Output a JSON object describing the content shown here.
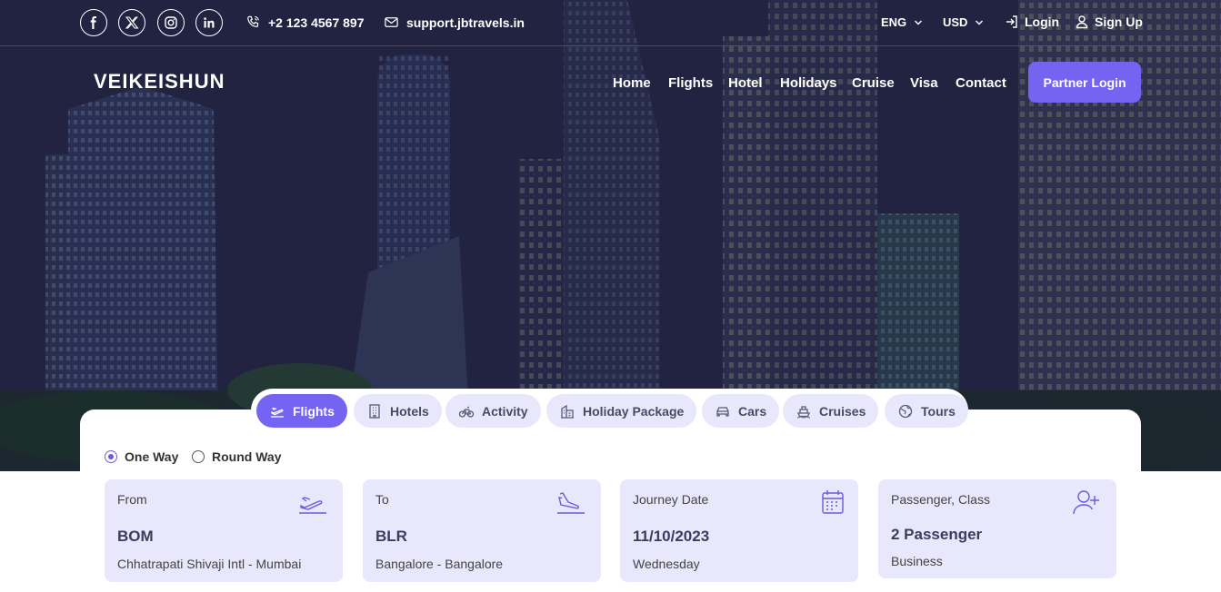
{
  "topbar": {
    "socials": [
      "facebook-icon",
      "x-icon",
      "instagram-icon",
      "linkedin-icon"
    ],
    "phone": "+2 123 4567 897",
    "email": "support.jbtravels.in",
    "language": "ENG",
    "currency": "USD",
    "login": "Login",
    "signup": "Sign Up"
  },
  "header": {
    "logo": "VEIKEISHUN",
    "nav": [
      "Home",
      "Flights",
      "Hotel",
      "Holidays",
      "Cruise",
      "Visa",
      "Contact"
    ],
    "partner_login": "Partner Login"
  },
  "search": {
    "tabs": [
      {
        "label": "Flights",
        "icon": "plane-icon",
        "active": true
      },
      {
        "label": "Hotels",
        "icon": "building-icon",
        "active": false
      },
      {
        "label": "Activity",
        "icon": "bicycle-icon",
        "active": false
      },
      {
        "label": "Holiday Package",
        "icon": "holiday-icon",
        "active": false
      },
      {
        "label": "Cars",
        "icon": "car-icon",
        "active": false
      },
      {
        "label": "Cruises",
        "icon": "ship-icon",
        "active": false
      },
      {
        "label": "Tours",
        "icon": "globe-icon",
        "active": false
      }
    ],
    "trip_types": [
      {
        "label": "One Way",
        "selected": true
      },
      {
        "label": "Round Way",
        "selected": false
      }
    ],
    "fields": [
      {
        "label": "From",
        "value": "BOM",
        "sub": "Chhatrapati Shivaji Intl - Mumbai",
        "icon": "takeoff-icon"
      },
      {
        "label": "To",
        "value": "BLR",
        "sub": "Bangalore - Bangalore",
        "icon": "landing-icon"
      },
      {
        "label": "Journey Date",
        "value": "11/10/2023",
        "sub": "Wednesday",
        "icon": "calendar-icon"
      },
      {
        "label": "Passenger, Class",
        "value": "2 Passenger",
        "sub": "Business",
        "icon": "add-user-icon"
      }
    ]
  },
  "colors": {
    "accent": "#7563f2",
    "tab_bg": "#e9e7fb",
    "text_dark": "#3c3c5c"
  }
}
